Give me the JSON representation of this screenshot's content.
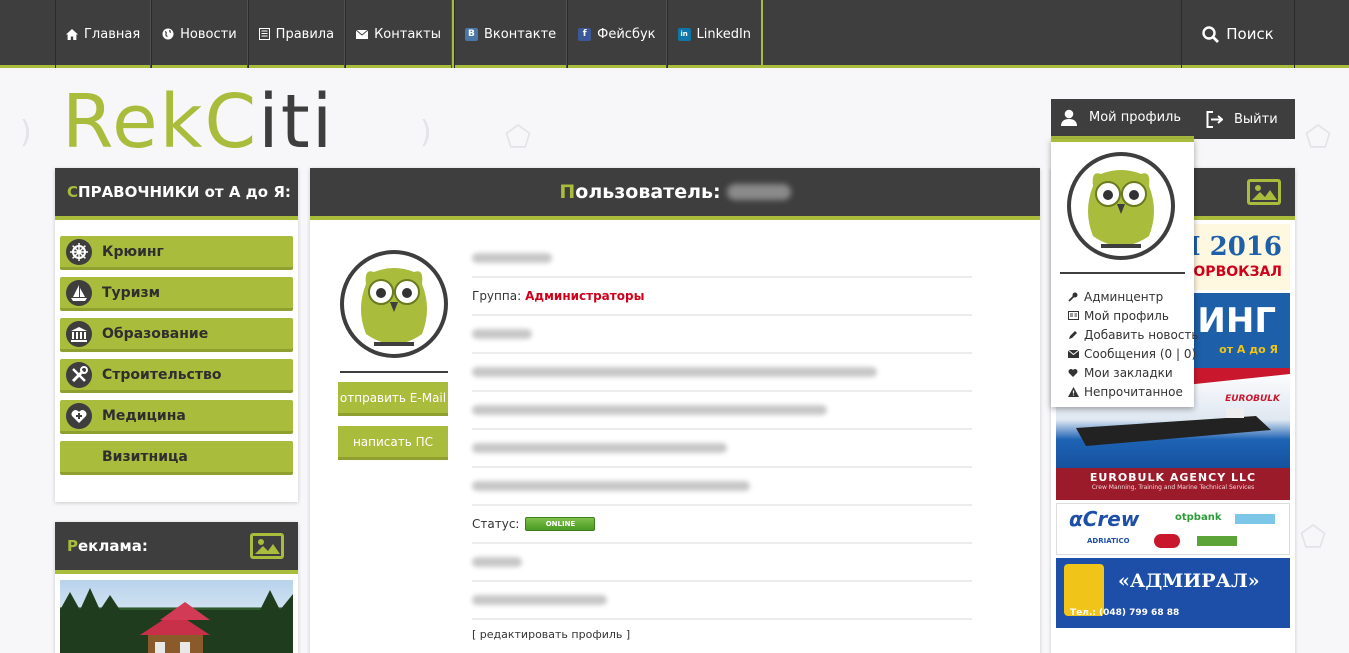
{
  "nav": {
    "items": [
      {
        "label": "Главная",
        "icon": "home-icon"
      },
      {
        "label": "Новости",
        "icon": "globe-icon"
      },
      {
        "label": "Правила",
        "icon": "document-icon"
      },
      {
        "label": "Контакты",
        "icon": "envelope-icon"
      }
    ],
    "social": [
      {
        "label": "Вконтакте",
        "icon": "vk-icon",
        "color": "#4a76a8",
        "glyph": "B"
      },
      {
        "label": "Фейсбук",
        "icon": "facebook-icon",
        "color": "#3b5998",
        "glyph": "f"
      },
      {
        "label": "LinkedIn",
        "icon": "linkedin-icon",
        "color": "#0e76a8",
        "glyph": "in"
      }
    ],
    "search_label": "Поиск"
  },
  "logo": {
    "part1": "Rek",
    "part2": "C",
    "part3": "iti"
  },
  "user_menu": {
    "profile_label": "Мой профиль",
    "logout_label": "Выйти",
    "dropdown": [
      {
        "label": "Админцентр",
        "icon": "key-icon"
      },
      {
        "label": "Мой профиль",
        "icon": "id-card-icon"
      },
      {
        "label": "Добавить новость",
        "icon": "pencil-icon"
      },
      {
        "label": "Сообщения (0 | 0)",
        "icon": "envelope-icon"
      },
      {
        "label": "Мои закладки",
        "icon": "heart-icon"
      },
      {
        "label": "Непрочитанное",
        "icon": "warning-icon"
      }
    ]
  },
  "catalog": {
    "title_first": "С",
    "title_rest": "ПРАВОЧНИКИ от А до Я:",
    "items": [
      {
        "label": "Крюинг",
        "icon": "ship-wheel-icon"
      },
      {
        "label": "Туризм",
        "icon": "sailboat-icon"
      },
      {
        "label": "Образование",
        "icon": "school-icon"
      },
      {
        "label": "Строительство",
        "icon": "tools-icon"
      },
      {
        "label": "Медицина",
        "icon": "medical-heart-icon"
      },
      {
        "label": "Визитница",
        "icon": ""
      }
    ]
  },
  "ads_left": {
    "title_first": "Р",
    "title_rest": "еклама:"
  },
  "profile": {
    "title_first": "П",
    "title_rest": "ользователь:",
    "email_button": "отправить E-Mail",
    "pm_button": "написать ПС",
    "group_label": "Группа:",
    "group_value": "Администраторы",
    "status_label": "Статус:",
    "status_value": "ONLINE",
    "edit_link": "[ редактировать профиль ]"
  },
  "ads_right": {
    "banner1_text": "ОНЯ 2016",
    "banner1_sub": "ОРВОКЗАЛ",
    "banner2_text": "ИНГ",
    "banner2_sub": "от А до Я",
    "eurobulk": "EUROBULK AGENCY LLC",
    "eurobulk_sub": "Crew Manning, Training and Marine Technical Services",
    "eurobulk_logo": "EUROBULK",
    "crew_logo": "αCrew",
    "otp_logo": "otpbank",
    "adriatico": "ADRIATICO",
    "admiral": "«АДМИРАЛ»",
    "admiral_phone": "Тел.: (048) 799 68 88"
  },
  "colors": {
    "accent": "#a9bc3c",
    "dark": "#3e3e3e",
    "alert": "#d0021b"
  }
}
